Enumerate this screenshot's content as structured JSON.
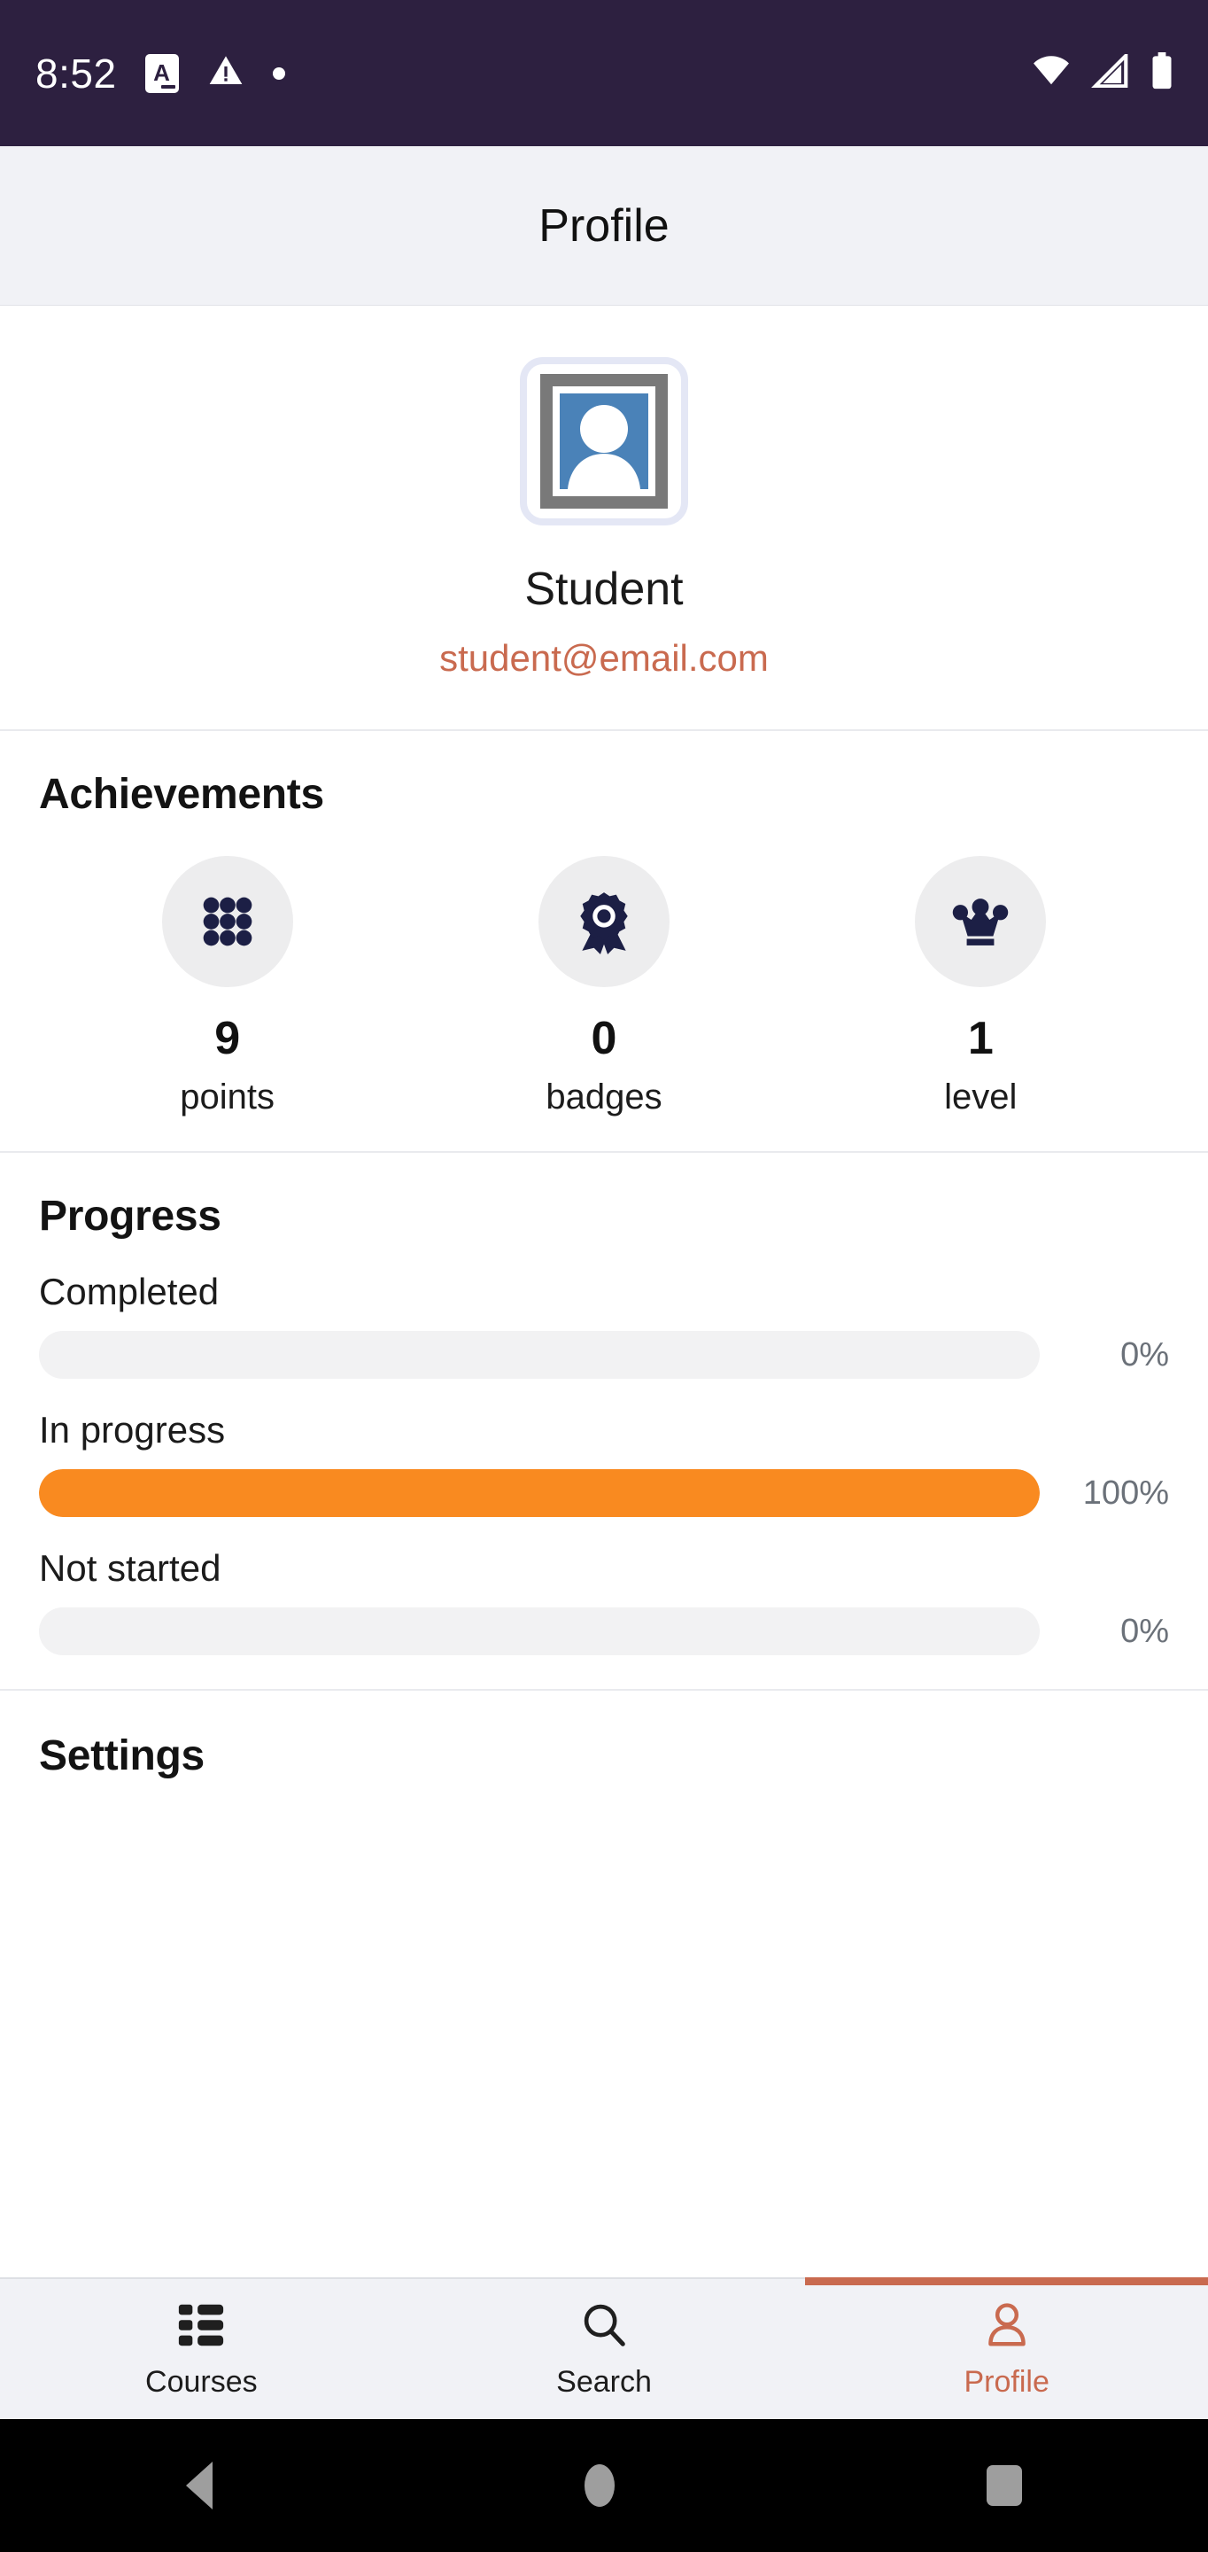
{
  "statusbar": {
    "time": "8:52",
    "app_badge_letter": "A",
    "icons": [
      "app-badge-icon",
      "warning-triangle-icon",
      "dot-icon",
      "wifi-icon",
      "cellular-signal-icon",
      "battery-icon"
    ],
    "background_color": "#2d2040"
  },
  "appbar": {
    "title": "Profile",
    "background_color": "#f1f2f6"
  },
  "profile": {
    "avatar_icon": "broken-image-portrait-placeholder",
    "name": "Student",
    "email": "student@email.com",
    "email_color": "#c96a4f"
  },
  "achievements": {
    "title": "Achievements",
    "stats": [
      {
        "icon": "dots-grid-icon",
        "value": "9",
        "label": "points"
      },
      {
        "icon": "award-rosette-icon",
        "value": "0",
        "label": "badges"
      },
      {
        "icon": "crown-icon",
        "value": "1",
        "label": "level"
      }
    ]
  },
  "progress": {
    "title": "Progress",
    "accent_color": "#f98a20",
    "track_color": "#f2f2f3",
    "bars": [
      {
        "label": "Completed",
        "percent_text": "0%",
        "percent": 0
      },
      {
        "label": "In progress",
        "percent_text": "100%",
        "percent": 100
      },
      {
        "label": "Not started",
        "percent_text": "0%",
        "percent": 0
      }
    ]
  },
  "settings": {
    "title": "Settings"
  },
  "bottom_nav": {
    "active_color": "#c96a4f",
    "items": [
      {
        "icon": "courses-list-icon",
        "label": "Courses",
        "active": false
      },
      {
        "icon": "search-icon",
        "label": "Search",
        "active": false
      },
      {
        "icon": "person-icon",
        "label": "Profile",
        "active": true
      }
    ]
  },
  "system_nav": {
    "buttons": [
      "back-button",
      "home-button",
      "recents-button"
    ]
  }
}
